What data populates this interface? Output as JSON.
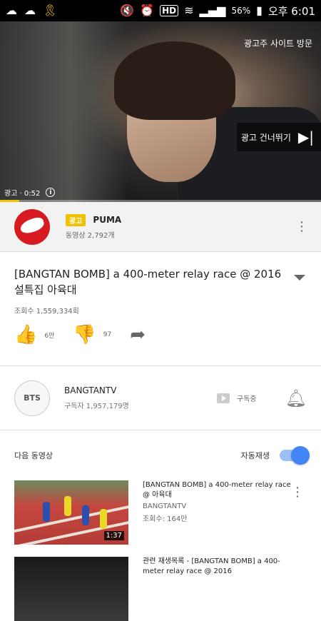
{
  "status_bar": {
    "left_icons": [
      "cloud-icon",
      "cloud-icon",
      "ribbon-icon"
    ],
    "mute": "🔇",
    "alarm": "⏰",
    "hd": "HD",
    "battery_pct": "56%",
    "time": "오후 6:01"
  },
  "ad_video": {
    "advertiser_visit": "광고주 사이트 방문",
    "skip_label": "광고 건너뛰기",
    "ad_time": "광고 · 0:52",
    "progress_fraction": 0.06
  },
  "ad_row": {
    "badge": "광고",
    "brand": "PUMA",
    "video_count": "동영상 2,792개"
  },
  "video": {
    "title": "[BANGTAN BOMB] a 400-meter relay race @ 2016 설특집 아육대",
    "views": "조회수 1,559,334회",
    "likes": "6만",
    "dislikes": "97"
  },
  "channel": {
    "avatar_text": "BTS",
    "name": "BANGTANTV",
    "subscribers": "구독자 1,957,179명",
    "subscribe_label": "구독중"
  },
  "up_next": {
    "label": "다음 동영상",
    "autoplay_label": "자동재생",
    "autoplay_on": true
  },
  "recommendations": [
    {
      "title": "[BANGTAN BOMB] a 400-meter relay race @ 아육대",
      "channel": "BANGTANTV",
      "views": "조회수: 164만",
      "duration": "1:37"
    },
    {
      "title": "관련 재생목록 - [BANGTAN BOMB] a 400-meter relay race @ 2016",
      "channel": "",
      "views": "",
      "duration": ""
    }
  ],
  "colors": {
    "ad_yellow": "#f2c200",
    "puma_red": "#d71920",
    "like_blue": "#4285f4"
  }
}
